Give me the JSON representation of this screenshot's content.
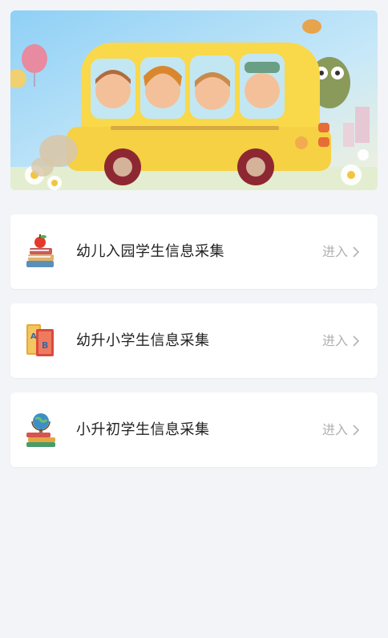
{
  "banner": {
    "alt_icon": "school-bus-illustration"
  },
  "cards": [
    {
      "title": "幼儿入园学生信息采集",
      "action": "进入",
      "icon": "apple-on-books-icon"
    },
    {
      "title": "幼升小学生信息采集",
      "action": "进入",
      "icon": "ab-books-icon"
    },
    {
      "title": "小升初学生信息采集",
      "action": "进入",
      "icon": "globe-on-books-icon"
    }
  ]
}
